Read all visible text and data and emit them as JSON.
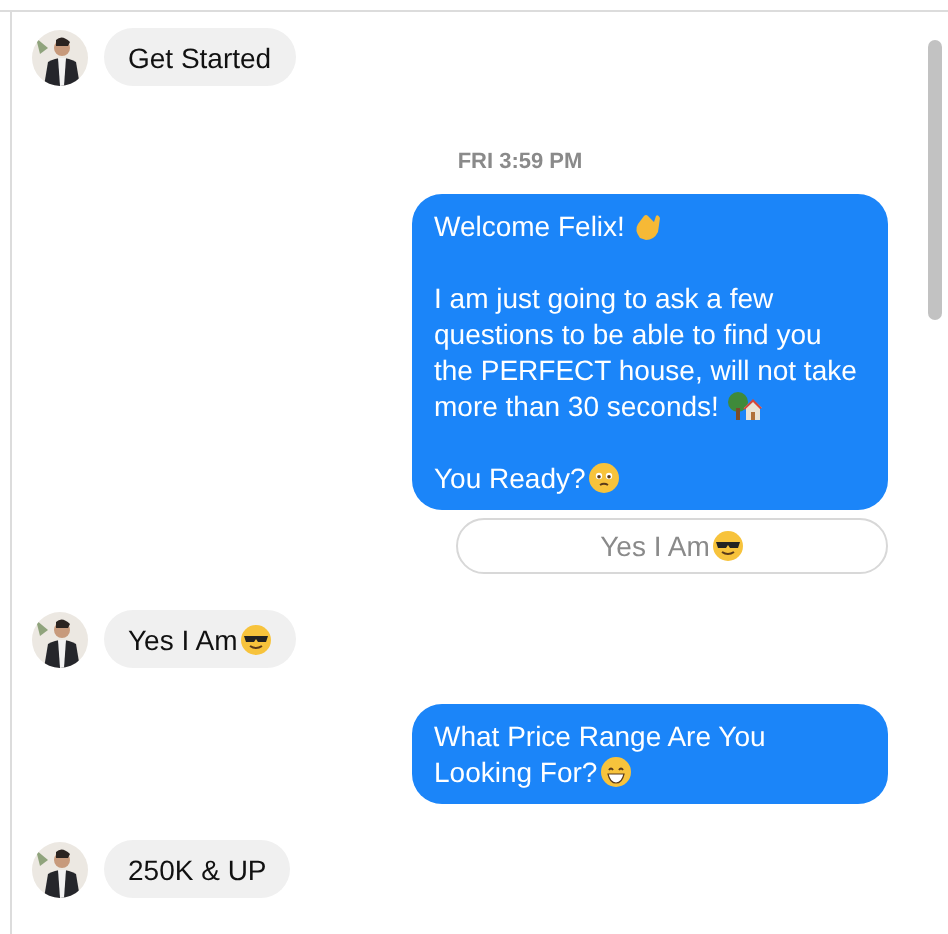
{
  "messages": [
    {
      "kind": "incoming",
      "paragraphs": [
        {
          "text": "Get Started"
        }
      ]
    },
    {
      "kind": "timestamp",
      "text": "FRI 3:59 PM"
    },
    {
      "kind": "outgoing",
      "paragraphs": [
        {
          "text": "Welcome Felix!"
        },
        {
          "text": "I am just going to ask a few questions to be able to find you the PERFECT house, will not take more than 30 seconds!"
        },
        {
          "text": "You Ready?"
        }
      ]
    },
    {
      "kind": "quick_reply",
      "text": "Yes I Am"
    },
    {
      "kind": "incoming",
      "paragraphs": [
        {
          "text": "Yes I Am"
        }
      ]
    },
    {
      "kind": "outgoing",
      "paragraphs": [
        {
          "text": "What Price Range Are You Looking For?"
        }
      ]
    },
    {
      "kind": "incoming",
      "paragraphs": [
        {
          "text": "250K & UP"
        }
      ]
    }
  ]
}
